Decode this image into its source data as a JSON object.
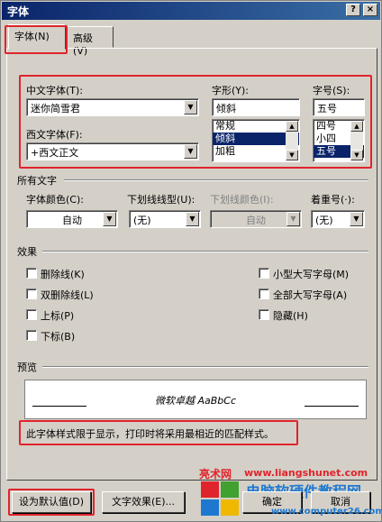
{
  "window": {
    "title": "字体",
    "help": "?",
    "close": "×"
  },
  "tabs": [
    {
      "label": "字体(N)"
    },
    {
      "label": "高级(V)"
    }
  ],
  "font": {
    "chinese_label": "中文字体(T):",
    "chinese_value": "迷你简雪君",
    "western_label": "西文字体(F):",
    "western_value": "+西文正文",
    "style_label": "字形(Y):",
    "style_value": "倾斜",
    "style_options": [
      "常规",
      "倾斜",
      "加粗"
    ],
    "size_label": "字号(S):",
    "size_value": "五号",
    "size_options": [
      "四号",
      "小四",
      "五号"
    ]
  },
  "all_text": {
    "heading": "所有文字",
    "color_label": "字体颜色(C):",
    "color_value": "自动",
    "underline_label": "下划线线型(U):",
    "underline_value": "(无)",
    "underline_color_label": "下划线颜色(I):",
    "underline_color_value": "自动",
    "emphasis_label": "着重号(·):",
    "emphasis_value": "(无)"
  },
  "effects": {
    "heading": "效果",
    "left": [
      "删除线(K)",
      "双删除线(L)",
      "上标(P)",
      "下标(B)"
    ],
    "right": [
      "小型大写字母(M)",
      "全部大写字母(A)",
      "隐藏(H)"
    ]
  },
  "preview": {
    "heading": "预览",
    "sample": "微软卓越 AaBbCc",
    "note": "此字体样式限于显示，打印时将采用最相近的匹配样式。"
  },
  "buttons": {
    "default": "设为默认值(D)",
    "text_effects": "文字效果(E)...",
    "ok": "确定",
    "cancel": "取消"
  },
  "watermark": {
    "site_cn": "亮术网",
    "site_url": "www.liangshunet.com",
    "brand": "电脑软硬件教程网",
    "brand_url": "www.computer26.com"
  },
  "colors": {
    "title_bar": "#0a246a",
    "highlight": "#e0242b",
    "selection": "#0a246a"
  }
}
